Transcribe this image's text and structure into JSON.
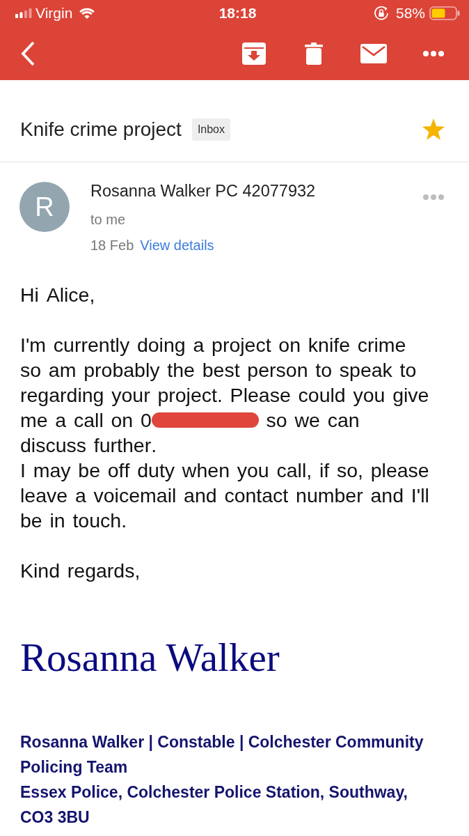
{
  "status_bar": {
    "carrier": "Virgin",
    "time": "18:18",
    "battery": "58%"
  },
  "subject": {
    "title": "Knife crime project",
    "label": "Inbox",
    "starred": true
  },
  "message": {
    "sender_initial": "R",
    "sender": "Rosanna Walker PC 42077932",
    "recipient": "to me",
    "date": "18 Feb",
    "details_link": "View details"
  },
  "body": [
    {
      "lines": [
        [
          {
            "kind": "text",
            "text": "Hi Alice,"
          }
        ]
      ]
    },
    {
      "lines": [
        [
          {
            "kind": "text",
            "text": "I'm currently doing a project on knife crime so am probably the best person to speak to regarding your project. Please could you give"
          }
        ],
        [
          {
            "kind": "text",
            "text": "me a call on 0"
          },
          {
            "kind": "redaction"
          },
          {
            "kind": "text",
            "text": "so we can"
          }
        ],
        [
          {
            "kind": "text",
            "text": "discuss further."
          }
        ],
        [
          {
            "kind": "text",
            "text": "I may be off duty when you call, if so, please leave a voicemail and contact number and I'll be in touch."
          }
        ]
      ]
    },
    {
      "lines": [
        [
          {
            "kind": "text",
            "text": "Kind regards,"
          }
        ]
      ]
    }
  ],
  "signature": {
    "name": "Rosanna Walker",
    "details": [
      "Rosanna Walker | Constable | Colchester Community Policing Team",
      "Essex Police, Colchester Police Station, Southway, CO3 3BU"
    ]
  }
}
